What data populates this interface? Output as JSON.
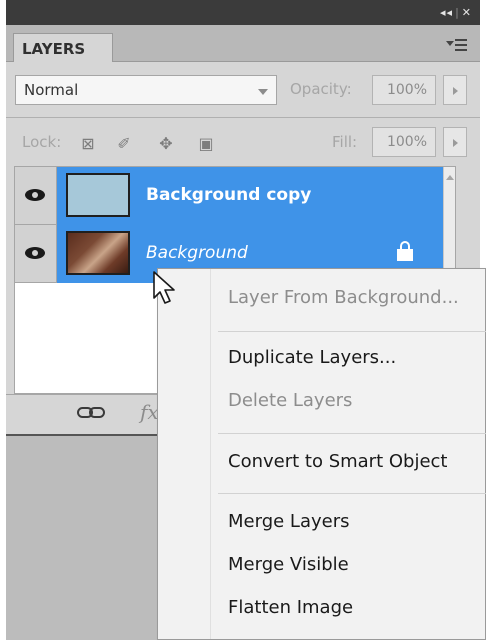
{
  "window": {
    "collapse_glyph": "◂◂",
    "close_glyph": "✕"
  },
  "panel": {
    "tab_label": "LAYERS",
    "blend_mode": "Normal",
    "opacity_label": "Opacity:",
    "opacity_value": "100%",
    "lock_label": "Lock:",
    "fill_label": "Fill:",
    "fill_value": "100%"
  },
  "lock_icons": [
    "lock-transparent-pixels-icon",
    "lock-image-pixels-icon",
    "lock-position-icon",
    "lock-all-icon"
  ],
  "layers": [
    {
      "name": "Background copy",
      "selected": true,
      "visible": true,
      "thumbnail": "light-blue",
      "style": "bold"
    },
    {
      "name": "Background",
      "selected": true,
      "visible": true,
      "thumbnail": "photo",
      "style": "italic",
      "locked": true
    }
  ],
  "bottom_bar": {
    "fx_label": "fx"
  },
  "context_menu": {
    "items": [
      {
        "label": "Layer From Background...",
        "enabled": false
      },
      {
        "label": "Duplicate Layers...",
        "enabled": true
      },
      {
        "label": "Delete Layers",
        "enabled": false
      },
      {
        "label": "Convert to Smart Object",
        "enabled": true
      },
      {
        "label": "Merge Layers",
        "enabled": true
      },
      {
        "label": "Merge Visible",
        "enabled": true
      },
      {
        "label": "Flatten Image",
        "enabled": true
      }
    ]
  },
  "colors": {
    "selection": "#3f93e8",
    "panel_bg": "#d6d6d6",
    "menu_bg": "#f2f2f2"
  }
}
